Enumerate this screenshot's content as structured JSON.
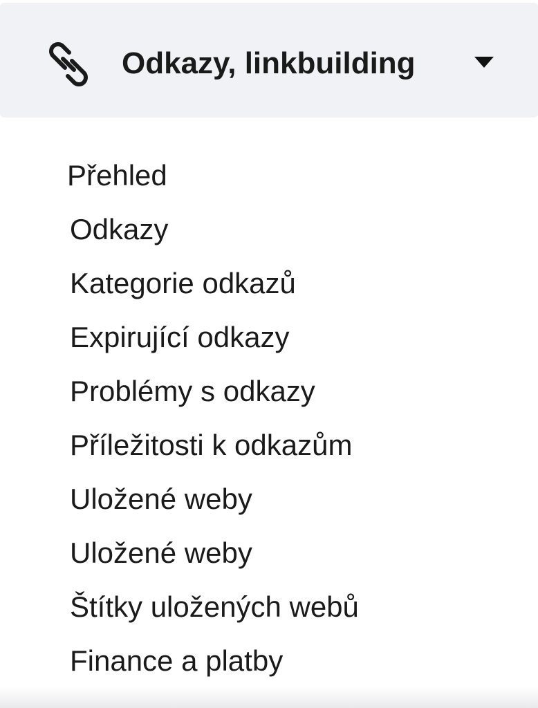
{
  "menu": {
    "header": {
      "icon": "link-icon",
      "title": "Odkazy, linkbuilding",
      "caret_icon": "caret-down-icon",
      "expanded": true
    },
    "items": [
      {
        "label": "Přehled"
      },
      {
        "label": "Odkazy"
      },
      {
        "label": "Kategorie odkazů"
      },
      {
        "label": "Expirující odkazy"
      },
      {
        "label": "Problémy s odkazy"
      },
      {
        "label": "Příležitosti k odkazům"
      },
      {
        "label": "Uložené weby"
      },
      {
        "label": "Uložené weby"
      },
      {
        "label": "Štítky uložených webů"
      },
      {
        "label": "Finance a platby"
      }
    ]
  },
  "colors": {
    "header_background": "#f1f2f6",
    "text": "#1a1a1a",
    "page_background": "#ffffff"
  }
}
